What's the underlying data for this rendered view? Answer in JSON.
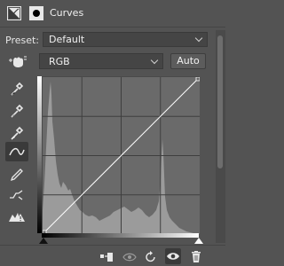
{
  "header": {
    "title": "Curves"
  },
  "preset": {
    "label": "Preset:",
    "value": "Default"
  },
  "channel": {
    "value": "RGB",
    "auto_label": "Auto"
  },
  "tools": [
    "hand-adjust",
    "sample-black-point",
    "sample-gray-point",
    "sample-white-point",
    "curve-points",
    "pencil",
    "smooth",
    "clipping-warning"
  ],
  "bottom_icons": [
    "clip-to-layer",
    "view-previous-state",
    "reset",
    "toggle-visibility",
    "delete"
  ],
  "colors": {
    "panel": "#535353",
    "graph_bg": "#6a6a6a",
    "histogram": "#9a9a9a",
    "curve": "#ffffff"
  }
}
